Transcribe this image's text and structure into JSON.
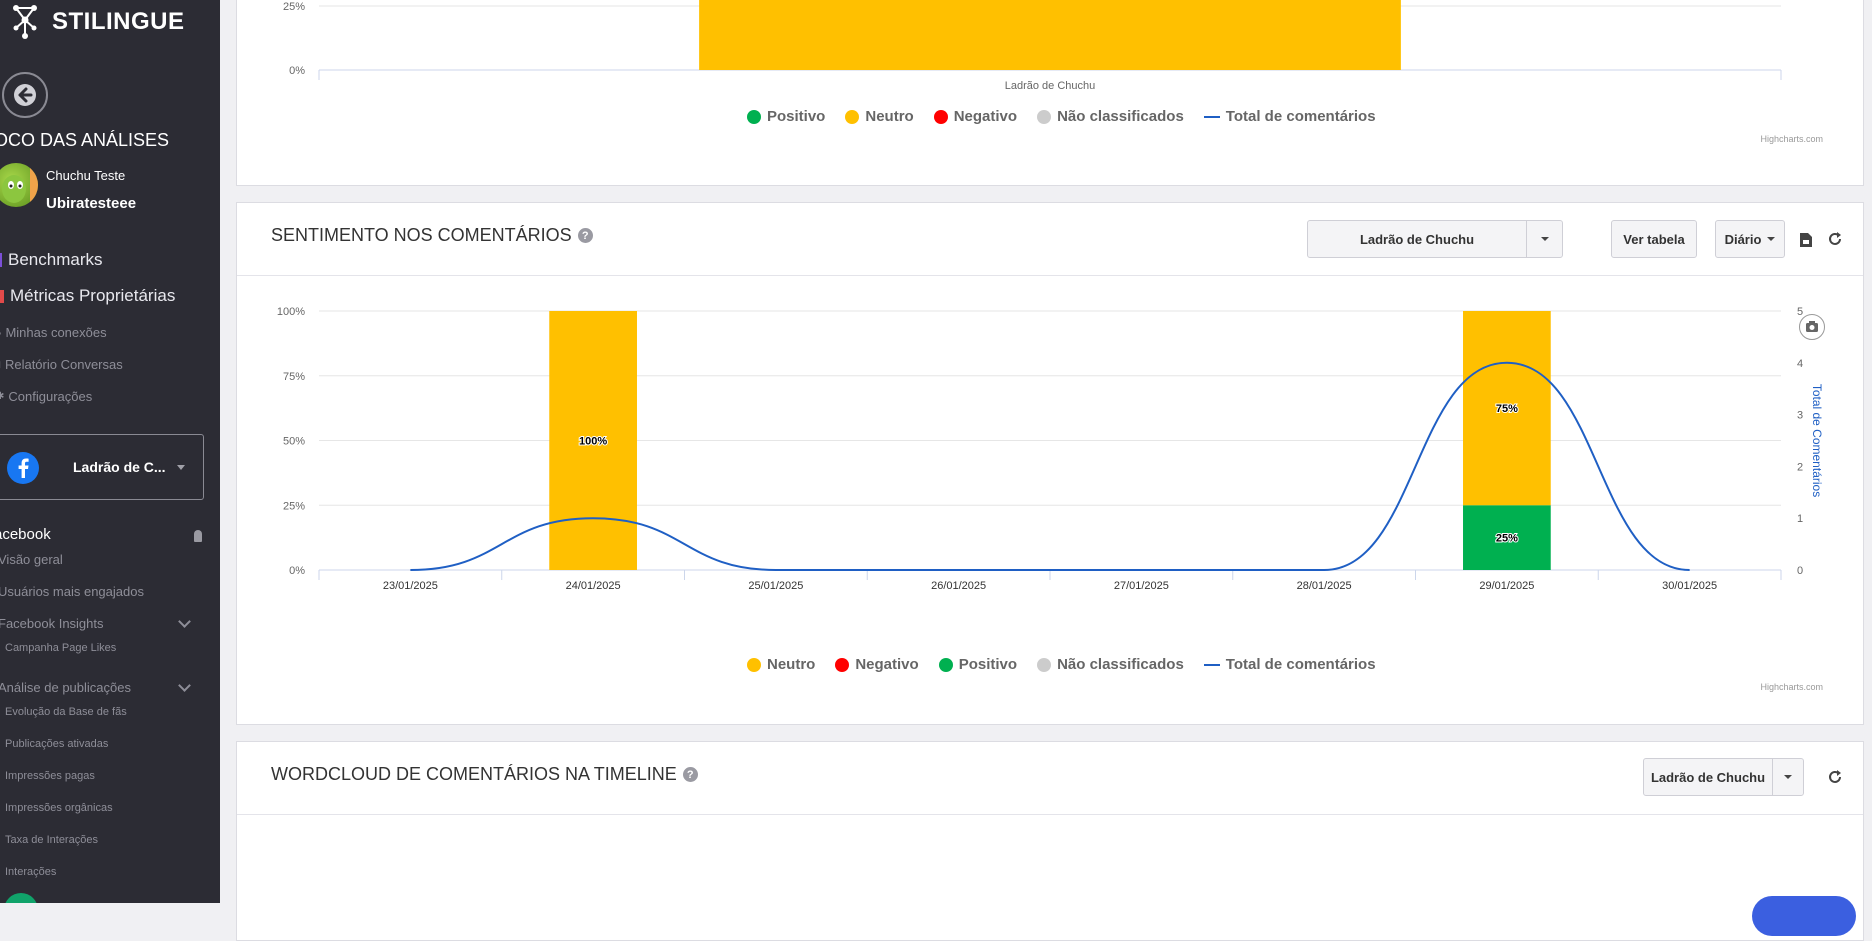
{
  "brand": {
    "name": "STILINGUE"
  },
  "sidebar": {
    "section_title": "OCO DAS ANÁLISES",
    "user_name": "Chuchu Teste",
    "user_handle": "Ubiratesteee",
    "main_items": [
      {
        "label": "Benchmarks",
        "icon": "benchmark-icon",
        "color": "#7b4fd6"
      },
      {
        "label": "Métricas Proprietárias",
        "icon": "bar-chart-icon",
        "color": "#e24a4a"
      }
    ],
    "sub_items": [
      {
        "label": "Minhas conexões",
        "icon": "connections-icon"
      },
      {
        "label": "Relatório Conversas",
        "icon": "report-icon"
      },
      {
        "label": "Configurações",
        "icon": "gear-icon"
      }
    ],
    "account": {
      "name": "Ladrão de C...",
      "network_icon": "facebook-icon"
    },
    "network_title": "acebook",
    "nav": [
      {
        "label": "Visão geral",
        "level": 1
      },
      {
        "label": "Usuários mais engajados",
        "level": 1
      },
      {
        "label": "Facebook Insights",
        "level": 1,
        "expandable": true
      },
      {
        "label": "Campanha Page Likes",
        "level": 2
      },
      {
        "label": "Análise de publicações",
        "level": 1,
        "expandable": true
      },
      {
        "label": "Evolução da Base de fãs",
        "level": 2
      },
      {
        "label": "Publicações ativadas",
        "level": 2
      },
      {
        "label": "Impressões pagas",
        "level": 2
      },
      {
        "label": "Impressões orgânicas",
        "level": 2
      },
      {
        "label": "Taxa de Interações",
        "level": 2
      },
      {
        "label": "Interações",
        "level": 2
      }
    ]
  },
  "top_card": {
    "credit": "Highcharts.com",
    "legend": [
      {
        "label": "Positivo",
        "color": "#00b050",
        "kind": "dot"
      },
      {
        "label": "Neutro",
        "color": "#ffc000",
        "kind": "dot"
      },
      {
        "label": "Negativo",
        "color": "#ff0000",
        "kind": "dot"
      },
      {
        "label": "Não classificados",
        "color": "#cccccc",
        "kind": "dot"
      },
      {
        "label": "Total de comentários",
        "color": "#1f5fc4",
        "kind": "line"
      }
    ]
  },
  "sentiment_card": {
    "title": "SENTIMENTO NOS COMENTÁRIOS",
    "profile_select": "Ladrão de Chuchu",
    "view_table": "Ver tabela",
    "period": "Diário",
    "credit": "Highcharts.com",
    "legend": [
      {
        "label": "Neutro",
        "color": "#ffc000",
        "kind": "dot"
      },
      {
        "label": "Negativo",
        "color": "#ff0000",
        "kind": "dot"
      },
      {
        "label": "Positivo",
        "color": "#00b050",
        "kind": "dot"
      },
      {
        "label": "Não classificados",
        "color": "#cccccc",
        "kind": "dot"
      },
      {
        "label": "Total de comentários",
        "color": "#1f5fc4",
        "kind": "line"
      }
    ]
  },
  "wordcloud_card": {
    "title": "WORDCLOUD DE COMENTÁRIOS NA TIMELINE",
    "profile_select": "Ladrão de Chuchu"
  },
  "chart_data": [
    {
      "type": "bar",
      "categories": [
        "Ladrão de Chuchu"
      ],
      "y_ticks": [
        "0%",
        "25%"
      ],
      "ylim": [
        0,
        100
      ],
      "series": [
        {
          "name": "Neutro",
          "color": "#ffc000",
          "values": [
            100
          ]
        }
      ]
    },
    {
      "type": "bar",
      "categories": [
        "23/01/2025",
        "24/01/2025",
        "25/01/2025",
        "26/01/2025",
        "27/01/2025",
        "28/01/2025",
        "29/01/2025",
        "30/01/2025"
      ],
      "y_ticks": [
        "0%",
        "25%",
        "50%",
        "75%",
        "100%"
      ],
      "ylim": [
        0,
        100
      ],
      "y2_ticks": [
        "0",
        "1",
        "2",
        "3",
        "4",
        "5"
      ],
      "y2lim": [
        0,
        5
      ],
      "y2label": "Total de Comentários",
      "stacked": true,
      "series": [
        {
          "name": "Neutro",
          "color": "#ffc000",
          "values": [
            0,
            100,
            0,
            0,
            0,
            0,
            75,
            0
          ],
          "labels": [
            "",
            "100%",
            "",
            "",
            "",
            "",
            "75%",
            ""
          ]
        },
        {
          "name": "Positivo",
          "color": "#00b050",
          "values": [
            0,
            0,
            0,
            0,
            0,
            0,
            25,
            0
          ],
          "labels": [
            "",
            "",
            "",
            "",
            "",
            "",
            "25%",
            ""
          ]
        },
        {
          "name": "Total de comentários",
          "type": "line",
          "color": "#1f5fc4",
          "axis": "y2",
          "values": [
            0,
            1,
            0,
            0,
            0,
            0,
            4,
            0
          ]
        }
      ]
    }
  ]
}
